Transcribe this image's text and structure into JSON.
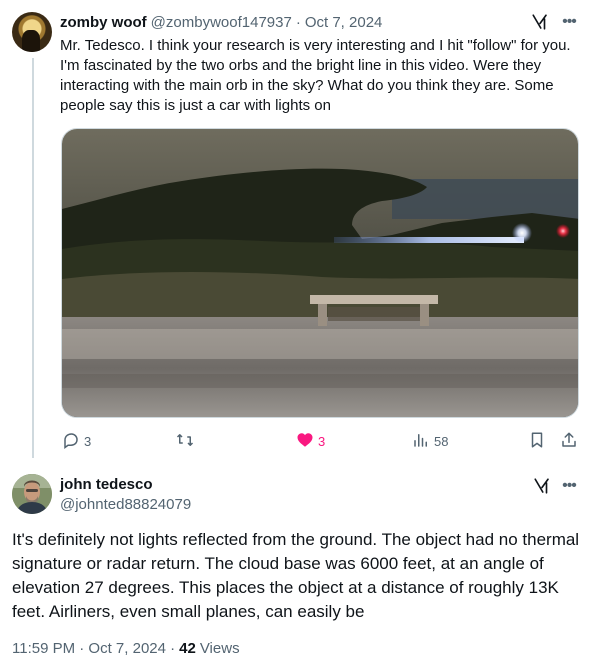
{
  "tweet1": {
    "author_name": "zomby woof",
    "author_handle": "@zombywoof147937",
    "separator": "·",
    "date": "Oct 7, 2024",
    "text": "Mr. Tedesco. I think your research is very interesting and I hit \"follow\" for you.  I'm fascinated by the two orbs and the bright line in this video. Were they interacting with the main orb in the sky? What do you think they are. Some people say this is just a car with lights on",
    "reply_count": "3",
    "like_count": "3",
    "view_count": "58",
    "icons": {
      "grok": "grok-icon",
      "more": "more-icon",
      "reply": "reply-icon",
      "retweet": "retweet-icon",
      "like": "heart-icon",
      "views": "views-icon",
      "bookmark": "bookmark-icon",
      "share": "share-icon"
    }
  },
  "tweet2": {
    "author_name": "john tedesco",
    "author_handle": "@johnted88824079",
    "text": "It's definitely not lights reflected from the ground. The object had no thermal signature or radar return. The cloud base was 6000 feet, at an angle of elevation 27 degrees. This places the object at a distance of roughly 13K feet. Airliners, even small planes, can easily be",
    "timestamp": "11:59 PM · Oct 7, 2024 ·",
    "views_count": "42",
    "views_label": "Views"
  },
  "colors": {
    "text_primary": "#0f1419",
    "text_secondary": "#536471",
    "like_pink": "#f91880",
    "border": "#cfd9de"
  }
}
